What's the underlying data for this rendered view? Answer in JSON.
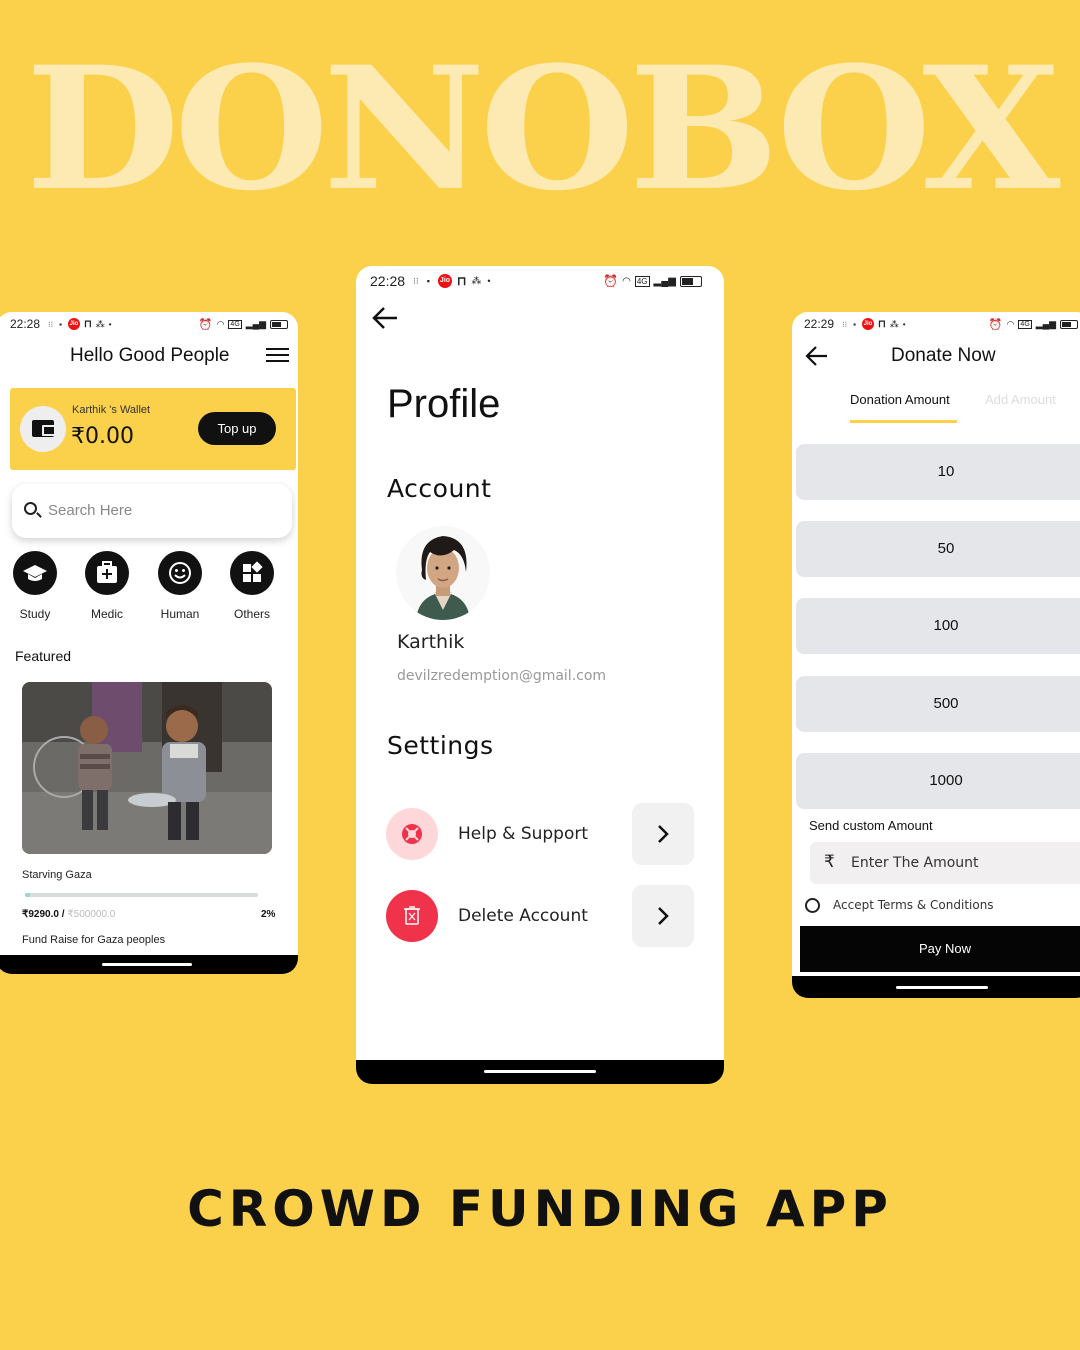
{
  "brand": {
    "title": "DONOBOX",
    "tagline": "CROWD FUNDING APP"
  },
  "phone_home": {
    "status": {
      "time": "22:28",
      "jio": "Jio"
    },
    "header": {
      "title": "Hello Good People"
    },
    "wallet": {
      "owner": "Karthik 's Wallet",
      "balance": "₹0.00",
      "topup_label": "Top up"
    },
    "search": {
      "placeholder": "Search Here"
    },
    "categories": [
      {
        "label": "Study",
        "icon": "graduation-cap-icon"
      },
      {
        "label": "Medic",
        "icon": "medical-kit-icon"
      },
      {
        "label": "Human",
        "icon": "smiley-icon"
      },
      {
        "label": "Others",
        "icon": "grid-icon"
      }
    ],
    "featured_label": "Featured",
    "campaign": {
      "title": "Starving Gaza",
      "raised": "₹9290.0 /",
      "goal": "₹500000.0",
      "percent": "2%",
      "progress_fraction": 0.02,
      "description": "Fund Raise for Gaza peoples"
    }
  },
  "phone_profile": {
    "status": {
      "time": "22:28",
      "jio": "Jio"
    },
    "title": "Profile",
    "account_label": "Account",
    "user": {
      "name": "Karthik",
      "email": "devilzredemption@gmail.com"
    },
    "settings_label": "Settings",
    "settings_items": [
      {
        "label": "Help & Support",
        "icon": "lifebuoy-icon"
      },
      {
        "label": "Delete Account",
        "icon": "trash-icon"
      }
    ]
  },
  "phone_donate": {
    "status": {
      "time": "22:29",
      "jio": "Jio"
    },
    "title": "Donate Now",
    "tabs": [
      {
        "label": "Donation Amount"
      },
      {
        "label": "Add Amount"
      }
    ],
    "amounts": [
      "10",
      "50",
      "100",
      "500",
      "1000"
    ],
    "custom_label": "Send custom Amount",
    "custom_input": {
      "currency": "₹",
      "placeholder": "Enter The Amount"
    },
    "terms_label": "Accept Terms & Conditions",
    "pay_label": "Pay Now"
  },
  "colors": {
    "background": "#FBD14B",
    "brand_text": "#FCEAB2",
    "accent": "#FBD14B",
    "danger": "#F0334A",
    "danger_soft": "#FDD7DA"
  }
}
